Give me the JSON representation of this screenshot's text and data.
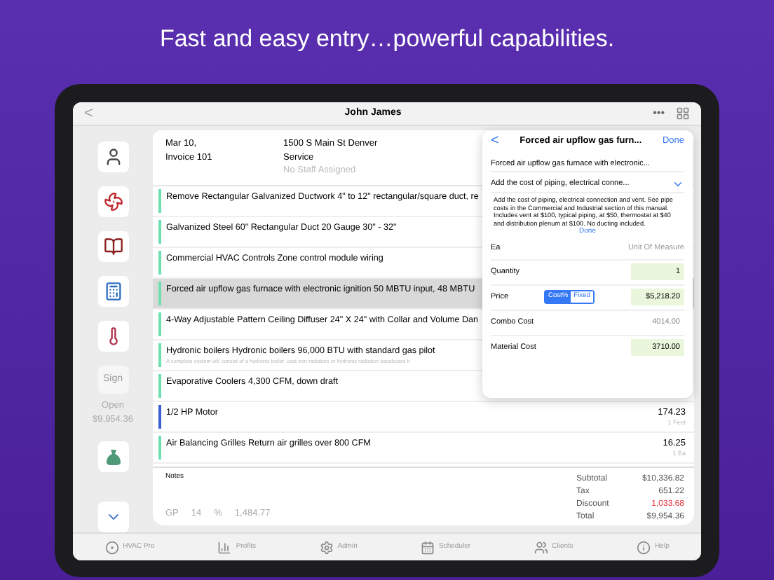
{
  "headline": "Fast and easy entry…powerful capabilities.",
  "header": {
    "back": "<",
    "title": "John James",
    "more": "•••"
  },
  "sidebar": {
    "sign": "Sign",
    "status": "Open",
    "amount": "$9,954.36"
  },
  "invoice": {
    "date": "Mar 10,",
    "number": "Invoice 101",
    "address": "1500 S Main St  Denver",
    "type": "Service",
    "staff": "No Staff Assigned"
  },
  "items": [
    {
      "title": "Remove Rectangular Galvanized Ductwork 4\" to 12\" rectangular/square duct, re",
      "color": "#6ee0b0",
      "selected": false
    },
    {
      "title": "Galvanized Steel 60\" Rectangular Duct 20 Gauge 30\" - 32\"",
      "color": "#6ee0b0",
      "selected": false
    },
    {
      "title": "Commercial HVAC Controls Zone control module wiring",
      "color": "#6ee0b0",
      "selected": false
    },
    {
      "title": "Forced air upflow gas furnace with electronic ignition 50 MBTU input,   48 MBTU",
      "color": "#6ee0b0",
      "selected": true
    },
    {
      "title": "4-Way Adjustable Pattern Ceiling Diffuser 24\" X 24\" with Collar and Volume Dan",
      "color": "#6ee0b0",
      "selected": false
    },
    {
      "title": "Hydronic boilers Hydronic boilers 96,000 BTU with standard gas pilot",
      "subtitle": "A complete system will consist of a hydronic boiler, cast iron radiators or hydronic radiation baseboard h",
      "color": "#6ee0b0",
      "selected": false
    },
    {
      "title": "Evaporative Coolers 4,300 CFM, down draft",
      "color": "#6ee0b0",
      "selected": false
    },
    {
      "title": "1/2 HP Motor",
      "price": "174.23",
      "unit": "1 Feet",
      "color": "#3b5fd0",
      "selected": false
    },
    {
      "title": "Air Balancing Grilles Return air grilles over 800 CFM",
      "price": "16.25",
      "unit": "1 Ea",
      "color": "#6ee0b0",
      "selected": false
    }
  ],
  "notes": {
    "label": "Notes",
    "gp_label": "GP",
    "gp": "14",
    "percent": "%",
    "gp_amount": "1,484.77"
  },
  "totals": [
    {
      "label": "Subtotal",
      "value": "$10,336.82",
      "kind": "normal"
    },
    {
      "label": "Tax",
      "value": "651.22",
      "kind": "normal"
    },
    {
      "label": "Discount",
      "value": "1,033.68",
      "kind": "negative"
    },
    {
      "label": "Total",
      "value": "$9,954.36",
      "kind": "normal"
    }
  ],
  "popover": {
    "back": "<",
    "title": "Forced air upflow gas furn...",
    "done": "Done",
    "name": "Forced air upflow gas furnace with electronic...",
    "note": "Add the cost of piping, electrical conne...",
    "description": "Add the cost of piping, electrical connection and vent. See pipe costs in the Commercial and Industrial section of this manual. Includes vent at $100, typical piping, at $50, thermostat at $40 and distribution plenum at $100. No ducting included.",
    "description_done": "Done",
    "unit": "Ea",
    "unit_label": "Unit Of Measure",
    "quantity_label": "Quantity",
    "quantity": "1",
    "price_label": "Price",
    "price_modes": [
      {
        "label": "Cost%",
        "selected": true
      },
      {
        "label": "Fixed",
        "selected": false
      }
    ],
    "price": "$5,218.20",
    "combo_label": "Combo Cost",
    "combo": "4014.00",
    "material_label": "Material Cost",
    "material": "3710.00"
  },
  "tabs": [
    {
      "label": "HVAC Pro",
      "kind": "target"
    },
    {
      "label": "Profits",
      "kind": "chart"
    },
    {
      "label": "Admin",
      "kind": "gear"
    },
    {
      "label": "Scheduler",
      "kind": "calendar"
    },
    {
      "label": "Clients",
      "kind": "people"
    },
    {
      "label": "Help",
      "kind": "info"
    }
  ]
}
